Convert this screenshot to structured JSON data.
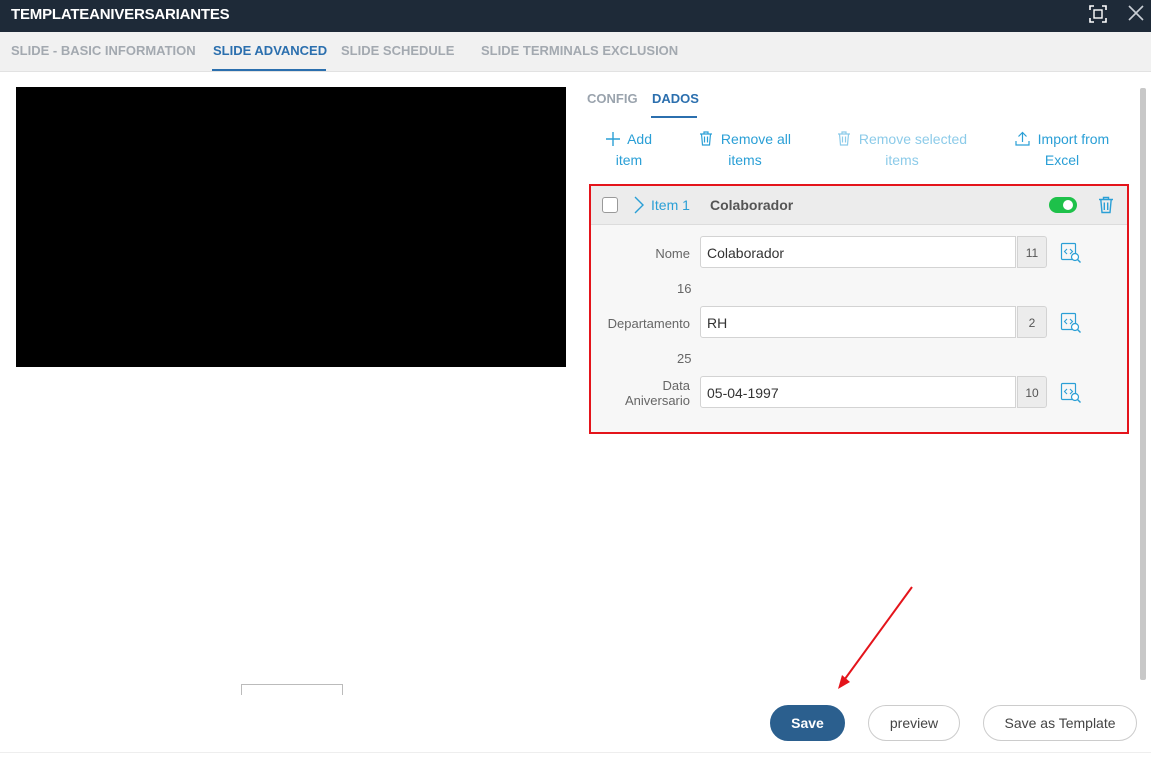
{
  "window": {
    "title": "TEMPLATEANIVERSARIANTES"
  },
  "tabs": [
    {
      "label": "SLIDE - BASIC INFORMATION",
      "active": false
    },
    {
      "label": "SLIDE ADVANCED",
      "active": true
    },
    {
      "label": "SLIDE SCHEDULE",
      "active": false
    },
    {
      "label": "SLIDE TERMINALS EXCLUSION",
      "active": false
    }
  ],
  "subtabs": [
    {
      "label": "CONFIG",
      "active": false
    },
    {
      "label": "DADOS",
      "active": true
    }
  ],
  "actions": {
    "add_item": {
      "line1": "Add",
      "line2": "item"
    },
    "remove_all": {
      "line1": "Remove all",
      "line2": "items"
    },
    "remove_selected": {
      "line1": "Remove selected",
      "line2": "items"
    },
    "import_excel": {
      "line1": "Import from",
      "line2": "Excel"
    }
  },
  "item": {
    "label": "Item 1",
    "name": "Colaborador",
    "enabled": true,
    "fields": [
      {
        "label": "Nome",
        "value": "Colaborador",
        "count": "11"
      },
      {
        "label": "Departamento",
        "value": "RH",
        "count": "2"
      },
      {
        "label_line1": "Data",
        "label_line2": "Aniversario",
        "value": "05-04-1997",
        "count": "10"
      }
    ],
    "counters": [
      "16",
      "25"
    ]
  },
  "buttons": {
    "save": "Save",
    "preview": "preview",
    "save_as_template": "Save as Template"
  },
  "colors": {
    "title_bar": "#1e2a38",
    "accent_blue": "#2b6fae",
    "link_blue": "#2a9fd6",
    "highlight_red": "#e4141b",
    "toggle_green": "#1ec14a",
    "save_button": "#2b5f8e"
  },
  "icons": {
    "maximize": "maximize-icon",
    "close": "close-icon",
    "add": "plus-icon",
    "trash": "trash-icon",
    "upload": "upload-icon",
    "chevron": "chevron-right-icon",
    "variable_search": "code-search-icon"
  }
}
